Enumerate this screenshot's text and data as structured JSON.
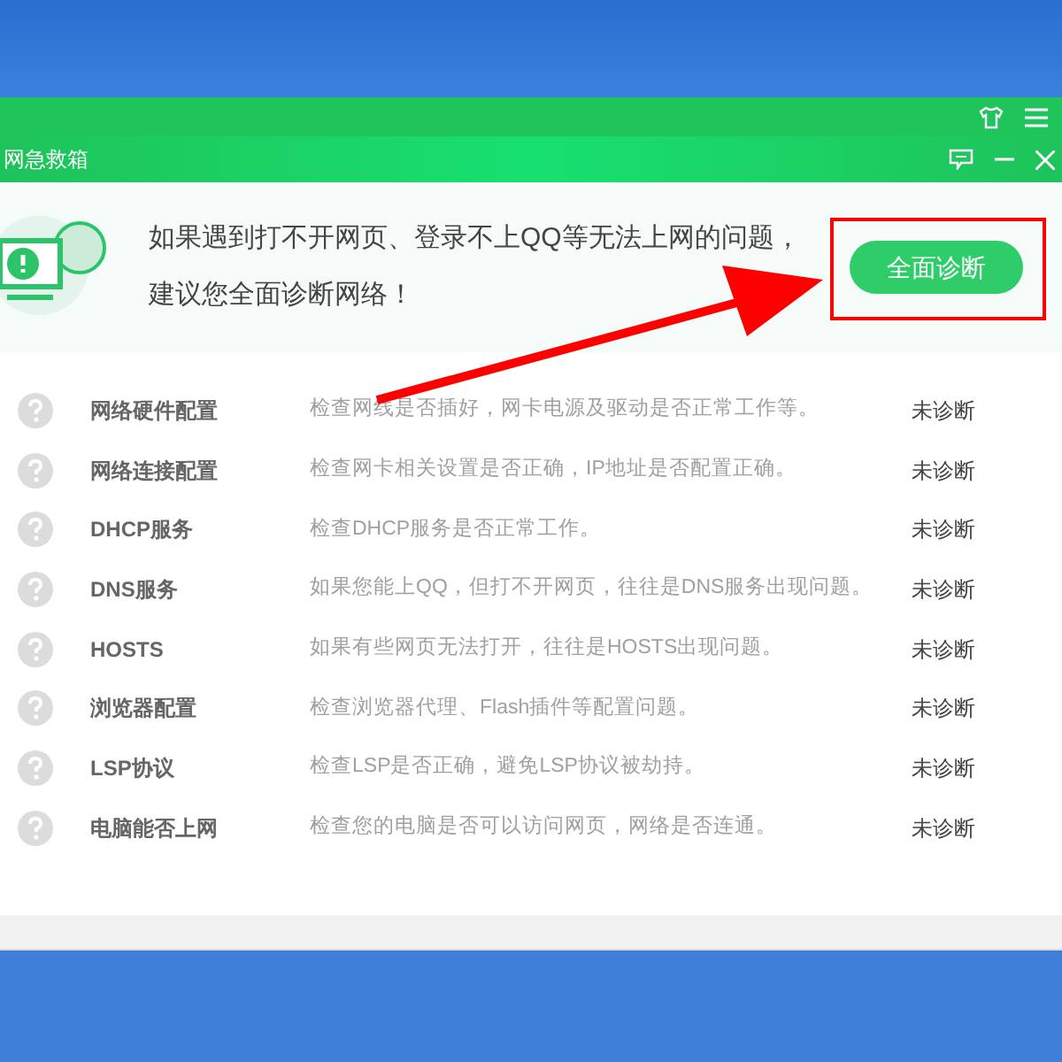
{
  "window": {
    "title": "网急救箱"
  },
  "banner": {
    "lines": [
      "如果遇到打不开网页、登录不上QQ等无法上网的问题，",
      "建议您全面诊断网络！"
    ],
    "button": "全面诊断"
  },
  "checks": [
    {
      "name": "网络硬件配置",
      "description": "检查网线是否插好，网卡电源及驱动是否正常工作等。",
      "status": "未诊断"
    },
    {
      "name": "网络连接配置",
      "description": "检查网卡相关设置是否正确，IP地址是否配置正确。",
      "status": "未诊断"
    },
    {
      "name": "DHCP服务",
      "description": "检查DHCP服务是否正常工作。",
      "status": "未诊断"
    },
    {
      "name": "DNS服务",
      "description": "如果您能上QQ，但打不开网页，往往是DNS服务出现问题。",
      "status": "未诊断"
    },
    {
      "name": "HOSTS",
      "description": "如果有些网页无法打开，往往是HOSTS出现问题。",
      "status": "未诊断"
    },
    {
      "name": "浏览器配置",
      "description": "检查浏览器代理、Flash插件等配置问题。",
      "status": "未诊断"
    },
    {
      "name": "LSP协议",
      "description": "检查LSP是否正确，避免LSP协议被劫持。",
      "status": "未诊断"
    },
    {
      "name": "电脑能否上网",
      "description": "检查您的电脑是否可以访问网页，网络是否连通。",
      "status": "未诊断"
    }
  ]
}
